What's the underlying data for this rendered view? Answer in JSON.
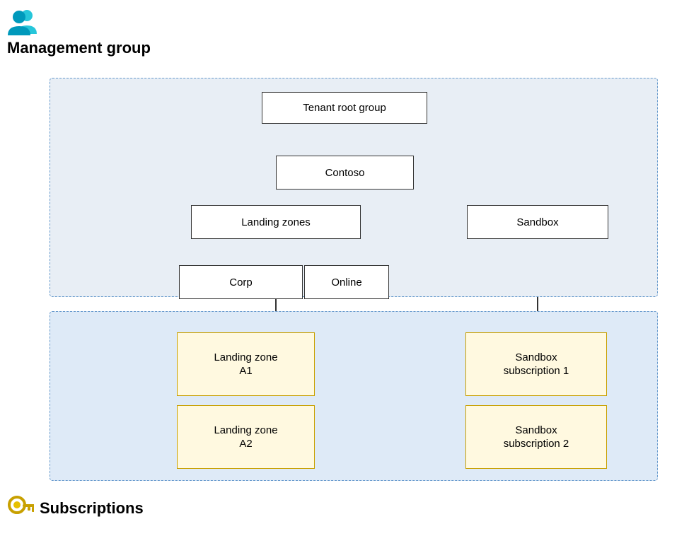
{
  "header": {
    "management_group_label": "Management group",
    "subscriptions_label": "Subscriptions"
  },
  "boxes": {
    "tenant_root": "Tenant root group",
    "contoso": "Contoso",
    "landing_zones": "Landing zones",
    "sandbox": "Sandbox",
    "corp": "Corp",
    "online": "Online",
    "lz_a1": "Landing zone\nA1",
    "lz_a2": "Landing zone\nA2",
    "sandbox_sub1": "Sandbox\nsubscription 1",
    "sandbox_sub2": "Sandbox\nsubscription 2"
  },
  "icons": {
    "users_icon": "👥",
    "key_icon": "🔑"
  }
}
